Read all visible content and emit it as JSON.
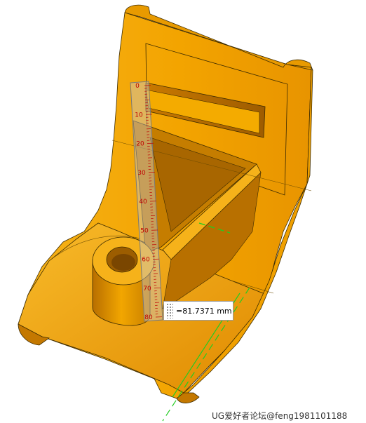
{
  "viewport": {
    "part_color": "#f5aa00",
    "edge_color": "#3d2b00",
    "background": "#ffffff"
  },
  "ruler": {
    "tick_labels": [
      "0",
      "10",
      "20",
      "30",
      "40",
      "50",
      "60",
      "70",
      "80"
    ],
    "label_color": "#c00000"
  },
  "measurement": {
    "value_text": "=81.7371 mm"
  },
  "axis_color": "#22cc22",
  "watermark": {
    "text": "UG爱好者论坛@feng1981101188"
  }
}
